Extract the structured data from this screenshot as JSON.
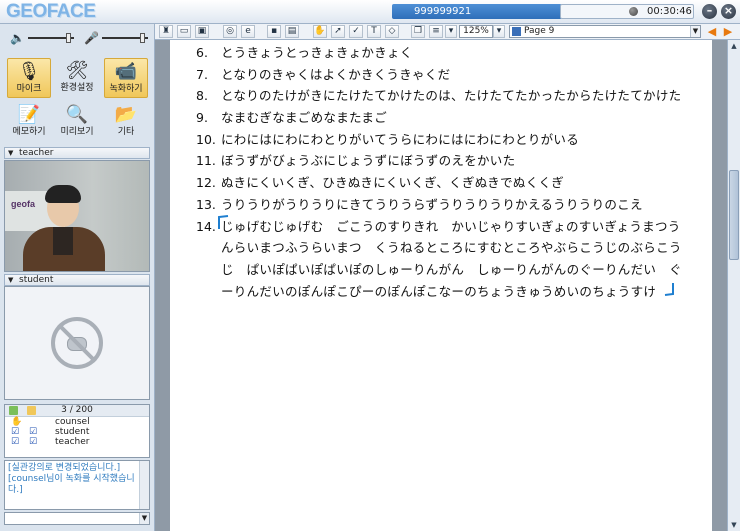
{
  "window": {
    "app_title": "GEOFACE",
    "session_id": "999999921",
    "elapsed_time": "00:30:46",
    "controls": [
      "minimize",
      "close"
    ]
  },
  "left_panel": {
    "tools_row1": [
      {
        "label": "마이크",
        "icon": "microphone-icon",
        "active": true
      },
      {
        "label": "환경설정",
        "icon": "settings-icon",
        "active": false
      },
      {
        "label": "녹화하기",
        "icon": "record-icon",
        "active": true
      }
    ],
    "tools_row2": [
      {
        "label": "메모하기",
        "icon": "memo-icon"
      },
      {
        "label": "미리보기",
        "icon": "preview-icon"
      },
      {
        "label": "기타",
        "icon": "folder-icon"
      }
    ],
    "teacher_label": "teacher",
    "student_label": "student",
    "video_banner_text": "geofa",
    "user_count": "3 / 200",
    "users": [
      {
        "name": "counsel",
        "hand": true,
        "check1": false,
        "check2": false
      },
      {
        "name": "student",
        "hand": false,
        "check1": true,
        "check2": true
      },
      {
        "name": "teacher",
        "hand": false,
        "check1": true,
        "check2": true
      }
    ],
    "chat_lines": [
      "[실관강의로 변경되었습니다.]",
      "[counsel님이 녹화를 시작했습니다.]"
    ]
  },
  "toolbar": {
    "zoom": "125%",
    "page": "Page 9"
  },
  "document": {
    "lines": [
      {
        "num": "6.",
        "text": "とうきょうとっきょきょかきょく"
      },
      {
        "num": "7.",
        "text": "となりのきゃくはよくかきくうきゃくだ"
      },
      {
        "num": "8.",
        "text": "となりのたけがきにたけたてかけたのは、たけたてたかったからたけたてかけた"
      },
      {
        "num": "9.",
        "text": "なまむぎなまごめなまたまご"
      },
      {
        "num": "10.",
        "text": "にわにはにわにわとりがいてうらにわにはにわにわとりがいる"
      },
      {
        "num": "11.",
        "text": "ぼうずがびょうぶにじょうずにぼうずのえをかいた"
      },
      {
        "num": "12.",
        "text": "ぬきにくいくぎ、ひきぬきにくいくぎ、くぎぬきでぬくくぎ"
      },
      {
        "num": "13.",
        "text": "うりうりがうりうりにきてうりうらずうりうりうりかえるうりうりのこえ"
      },
      {
        "num": "14.",
        "text": "じゅげむじゅげむ　ごこうのすりきれ　かいじゃりすいぎょのすいぎょうまつう"
      }
    ],
    "continuation": [
      "んらいまつふうらいまつ　くうねるところにすむところやぶらこうじのぶらこう",
      "じ　ぱいぽぱいぽぱいぽのしゅーりんがん　しゅーりんがんのぐーりんだい　ぐ",
      "ーりんだいのぽんぽこぴーのぽんぽこなーのちょうきゅうめいのちょうすけ"
    ]
  }
}
